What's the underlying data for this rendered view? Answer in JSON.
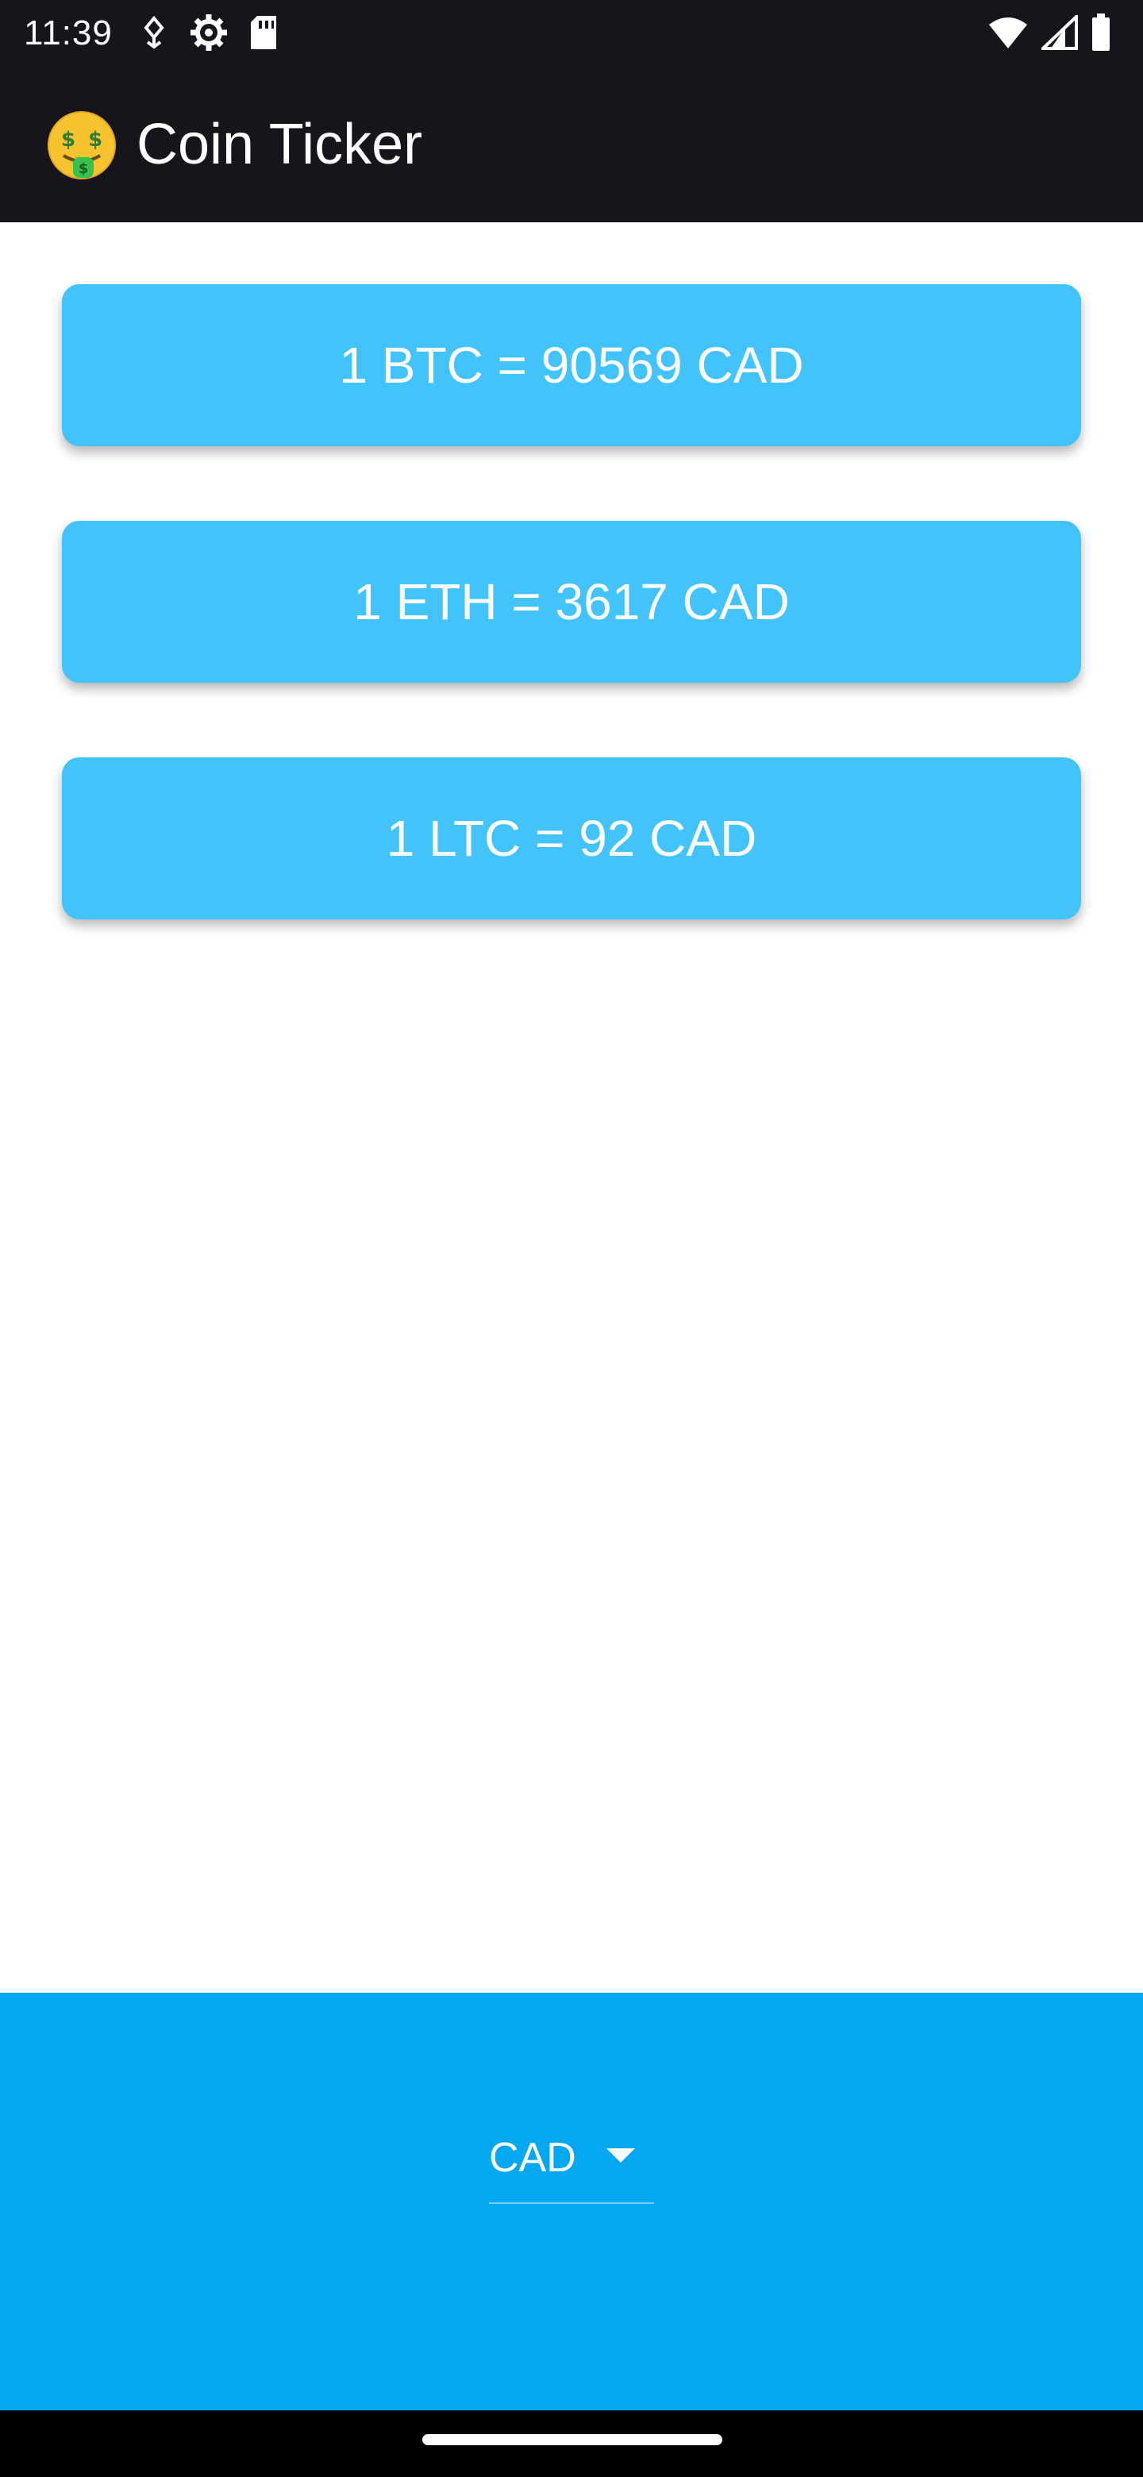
{
  "status_bar": {
    "time": "11:39",
    "left_icons": [
      "usb-debug-icon",
      "settings-gear-icon",
      "sd-card-icon"
    ],
    "right_icons": [
      "wifi-icon",
      "cell-signal-icon",
      "battery-icon"
    ]
  },
  "app_bar": {
    "icon": "money-mouth-face-icon",
    "title": "Coin Ticker"
  },
  "rates": [
    {
      "text": "1 BTC = 90569 CAD"
    },
    {
      "text": "1 ETH = 3617 CAD"
    },
    {
      "text": "1 LTC = 92 CAD"
    }
  ],
  "currency_picker": {
    "selected": "CAD",
    "icon": "dropdown-arrow-icon"
  },
  "colors": {
    "app_bar": "#16151c",
    "card": "#42c3fc",
    "bottom_panel": "#03a8f1"
  }
}
